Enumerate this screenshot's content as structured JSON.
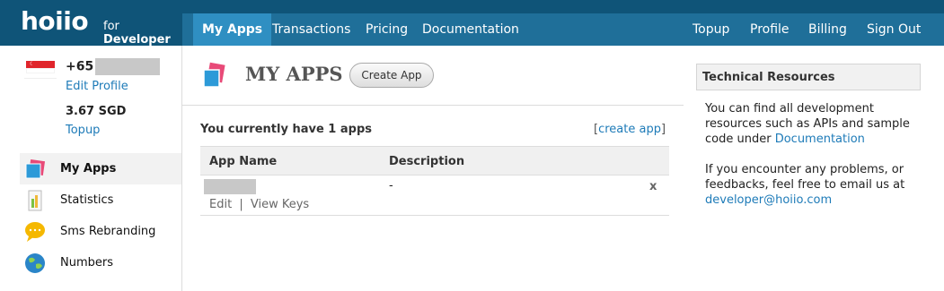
{
  "header": {
    "logo": "hoiio",
    "logo_sub_prefix": "for",
    "logo_sub_bold": "Developer",
    "nav_left": [
      "My Apps",
      "Transactions",
      "Pricing",
      "Documentation"
    ],
    "nav_right": [
      "Topup",
      "Profile",
      "Billing",
      "Sign Out"
    ]
  },
  "sidebar": {
    "phone_prefix": "+65",
    "edit_profile": "Edit Profile",
    "balance": "3.67 SGD",
    "topup": "Topup",
    "menu": [
      {
        "label": "My Apps",
        "icon": "my-apps-icon",
        "active": true
      },
      {
        "label": "Statistics",
        "icon": "statistics-icon",
        "active": false
      },
      {
        "label": "Sms Rebranding",
        "icon": "sms-rebranding-icon",
        "active": false
      },
      {
        "label": "Numbers",
        "icon": "numbers-icon",
        "active": false
      }
    ]
  },
  "main": {
    "title": "MY APPS",
    "create_button": "Create App",
    "apps_count_text": "You currently have 1 apps",
    "create_link_open": "[",
    "create_link": "create app",
    "create_link_close": "]",
    "columns": [
      "App Name",
      "Description"
    ],
    "rows": [
      {
        "name": "",
        "description": "-",
        "remove": "x",
        "edit": "Edit",
        "separator": "|",
        "view_keys": "View Keys"
      }
    ]
  },
  "resources": {
    "title": "Technical Resources",
    "para1_text": "You can find all development resources such as APIs and sample code under",
    "para1_link": "Documentation",
    "para2_text": "If you encounter any problems, or feedbacks, feel free to email us at",
    "para2_link": "developer@hoiio.com"
  },
  "colors": {
    "header_dark": "#0f5478",
    "nav_bar": "#1f6f99",
    "nav_active": "#2f8fc2",
    "link": "#1e7bb8"
  }
}
